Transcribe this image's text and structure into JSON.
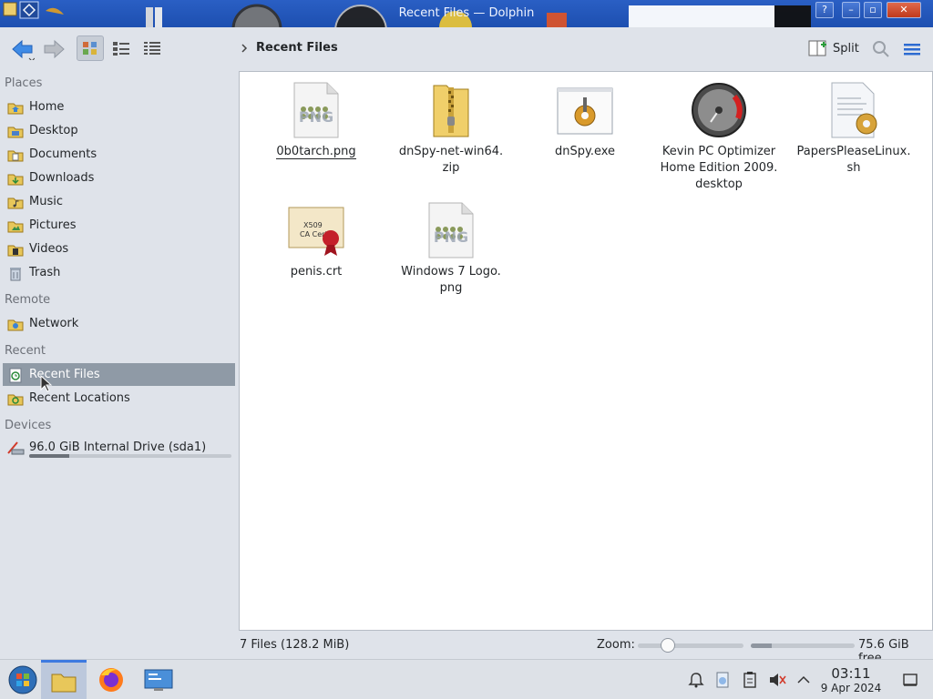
{
  "window": {
    "title": "Recent Files — Dolphin"
  },
  "toolbar": {
    "back": "back",
    "forward": "forward",
    "breadcrumb": "Recent Files",
    "split_label": "Split"
  },
  "sidebar": {
    "sections": {
      "places": "Places",
      "remote": "Remote",
      "recent": "Recent",
      "devices": "Devices"
    },
    "places": [
      "Home",
      "Desktop",
      "Documents",
      "Downloads",
      "Music",
      "Pictures",
      "Videos",
      "Trash"
    ],
    "remote": [
      "Network"
    ],
    "recent": [
      "Recent Files",
      "Recent Locations"
    ],
    "selected": "Recent Files",
    "devices": [
      {
        "label": "96.0 GiB Internal Drive (sda1)",
        "usage_fraction": 0.2
      }
    ]
  },
  "files": [
    {
      "name": "0b0tarch.png",
      "icon": "png-image-icon"
    },
    {
      "name": "dnSpy-net-win64.\nzip",
      "icon": "zip-folder-icon"
    },
    {
      "name": "dnSpy.exe",
      "icon": "exe-gear-icon"
    },
    {
      "name": "Kevin PC Optimizer\nHome Edition 2009.\ndesktop",
      "icon": "speedometer-icon"
    },
    {
      "name": "PapersPleaseLinux.\nsh",
      "icon": "script-icon"
    },
    {
      "name": "penis.crt",
      "icon": "certificate-icon"
    },
    {
      "name": "Windows 7 Logo.\npng",
      "icon": "png-image-icon"
    }
  ],
  "statusbar": {
    "count": "7 Files (128.2 MiB)",
    "zoom_label": "Zoom:",
    "zoom_fraction": 0.25,
    "space_used_fraction": 0.2,
    "free": "75.6 GiB free"
  },
  "taskbar": {
    "time": "03:11",
    "date": "9 Apr 2024"
  },
  "colors": {
    "selection": "#8f9aa6",
    "accent": "#3d7ae0",
    "titlebar": "#1d4fb0"
  }
}
